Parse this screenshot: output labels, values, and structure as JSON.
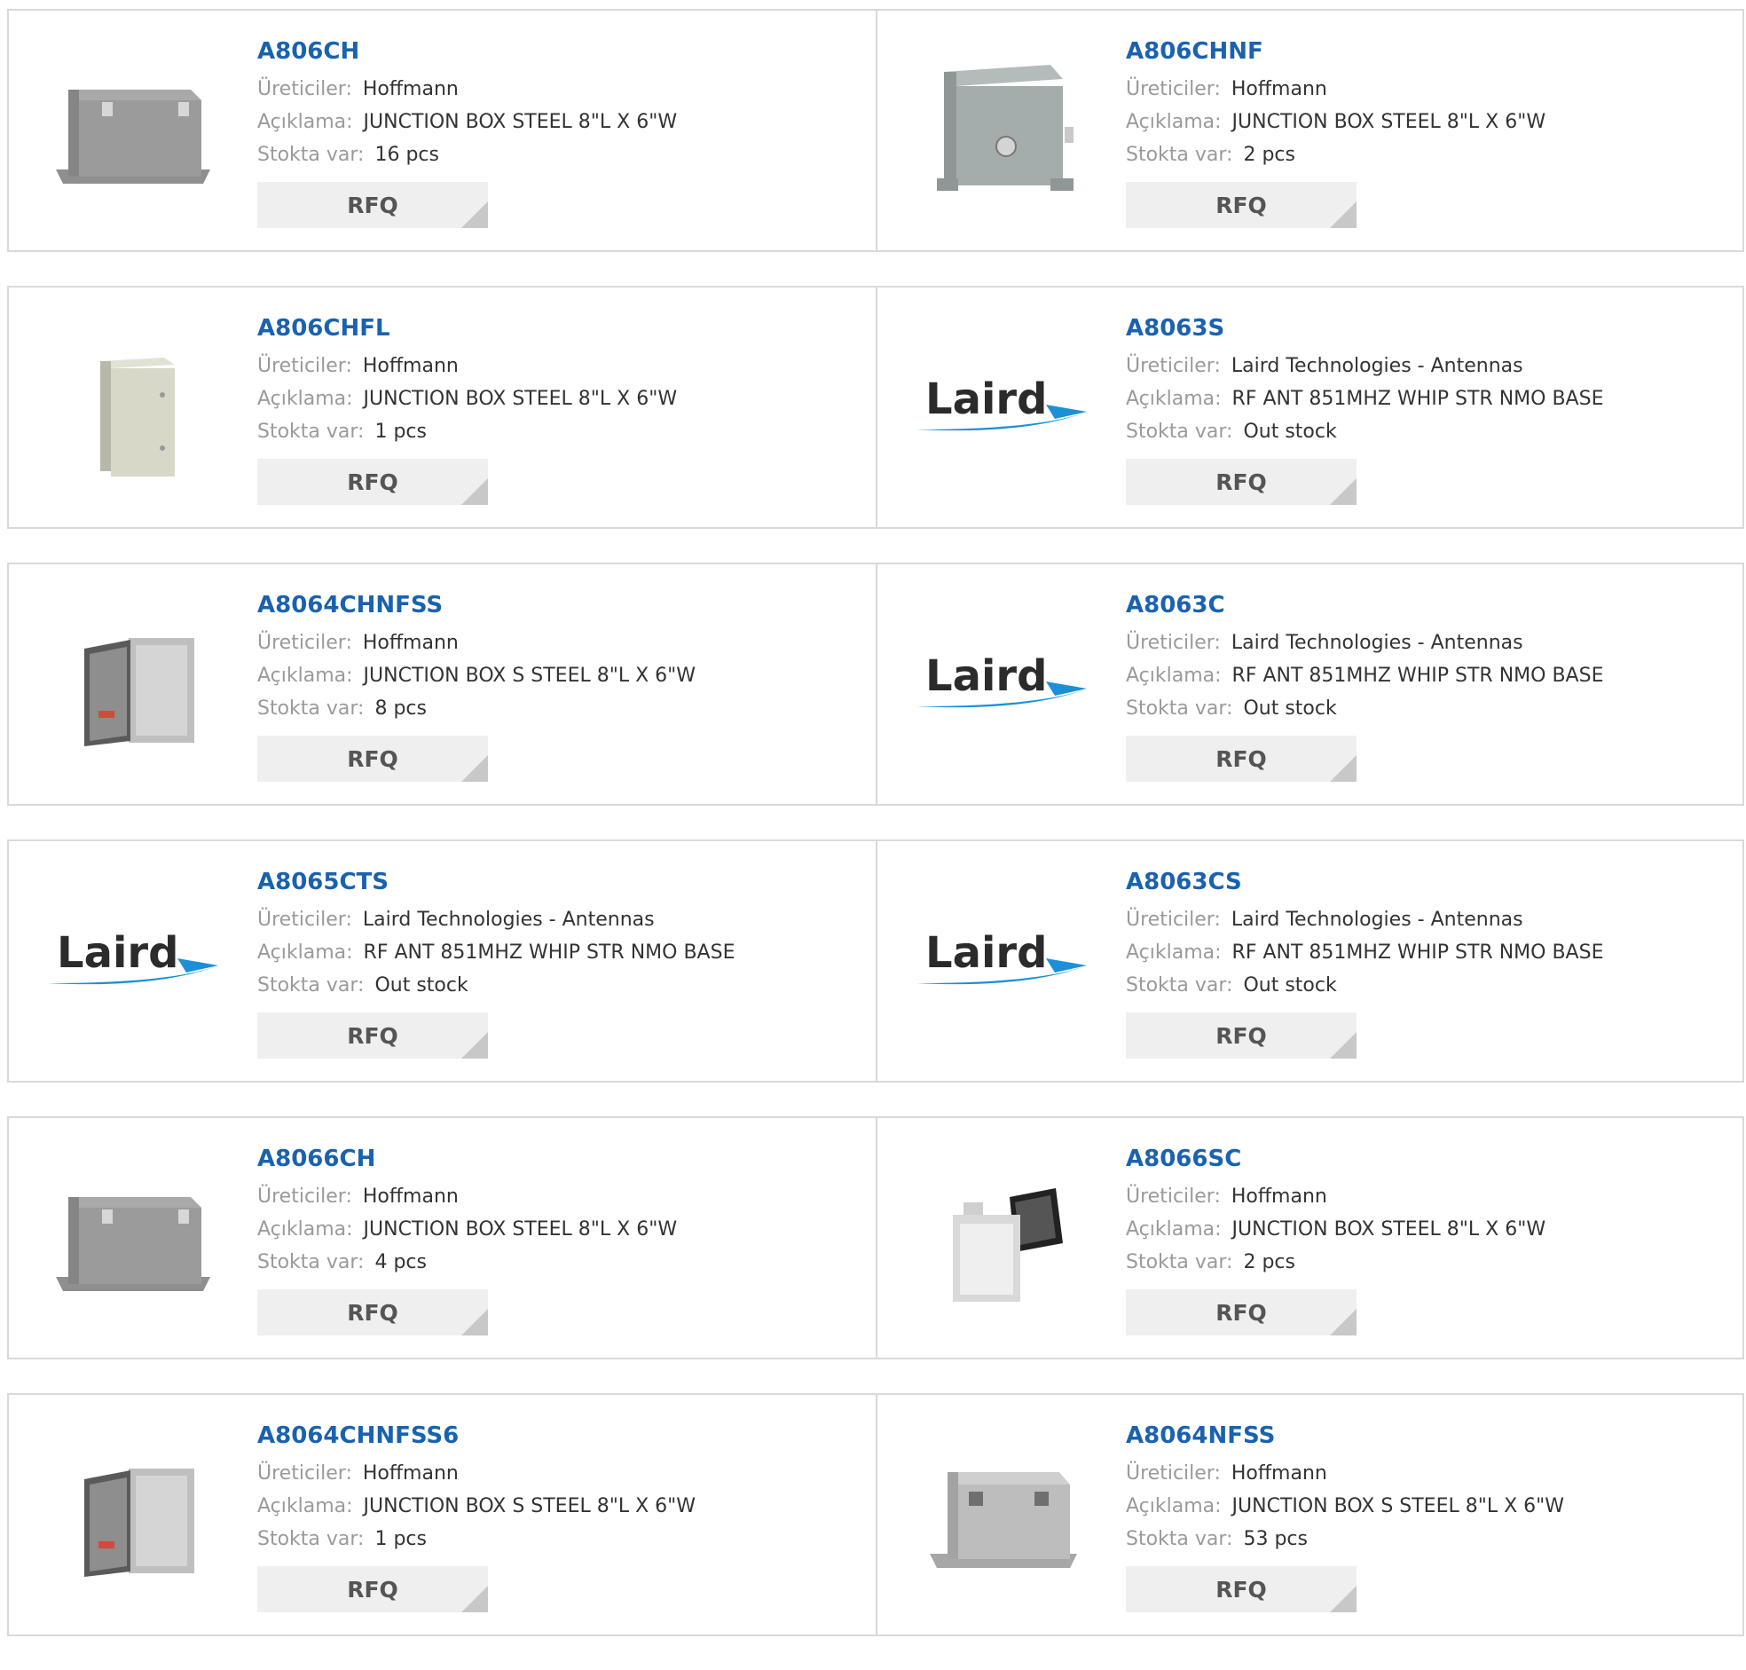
{
  "labels": {
    "manufacturer": "Üreticiler:",
    "description": "Açıklama:",
    "stock": "Stokta var:",
    "rfq": "RFQ"
  },
  "products": [
    {
      "part": "A806CH",
      "manufacturer": "Hoffmann",
      "description": "JUNCTION BOX STEEL 8\"L X 6\"W",
      "stock": "16 pcs",
      "image": "gray-enclosure-latches-icon"
    },
    {
      "part": "A806CHNF",
      "manufacturer": "Hoffmann",
      "description": "JUNCTION BOX STEEL 8\"L X 6\"W",
      "stock": "2 pcs",
      "image": "gray-enclosure-front-latch-icon"
    },
    {
      "part": "A806CHFL",
      "manufacturer": "Hoffmann",
      "description": "JUNCTION BOX STEEL 8\"L X 6\"W",
      "stock": "1 pcs",
      "image": "beige-enclosure-icon"
    },
    {
      "part": "A8063S",
      "manufacturer": "Laird Technologies - Antennas",
      "description": "RF ANT 851MHZ WHIP STR NMO BASE",
      "stock": "Out stock",
      "image": "laird-logo"
    },
    {
      "part": "A8064CHNFSS",
      "manufacturer": "Hoffmann",
      "description": "JUNCTION BOX S STEEL 8\"L X 6\"W",
      "stock": "8 pcs",
      "image": "stainless-enclosure-open-icon"
    },
    {
      "part": "A8063C",
      "manufacturer": "Laird Technologies - Antennas",
      "description": "RF ANT 851MHZ WHIP STR NMO BASE",
      "stock": "Out stock",
      "image": "laird-logo"
    },
    {
      "part": "A8065CTS",
      "manufacturer": "Laird Technologies - Antennas",
      "description": "RF ANT 851MHZ WHIP STR NMO BASE",
      "stock": "Out stock",
      "image": "laird-logo"
    },
    {
      "part": "A8063CS",
      "manufacturer": "Laird Technologies - Antennas",
      "description": "RF ANT 851MHZ WHIP STR NMO BASE",
      "stock": "Out stock",
      "image": "laird-logo"
    },
    {
      "part": "A8066CH",
      "manufacturer": "Hoffmann",
      "description": "JUNCTION BOX STEEL 8\"L X 6\"W",
      "stock": "4 pcs",
      "image": "gray-enclosure-latches-icon"
    },
    {
      "part": "A8066SC",
      "manufacturer": "Hoffmann",
      "description": "JUNCTION BOX STEEL 8\"L X 6\"W",
      "stock": "2 pcs",
      "image": "white-enclosure-open-lid-icon"
    },
    {
      "part": "A8064CHNFSS6",
      "manufacturer": "Hoffmann",
      "description": "JUNCTION BOX S STEEL 8\"L X 6\"W",
      "stock": "1 pcs",
      "image": "stainless-enclosure-open-icon"
    },
    {
      "part": "A8064NFSS",
      "manufacturer": "Hoffmann",
      "description": "JUNCTION BOX S STEEL 8\"L X 6\"W",
      "stock": "53 pcs",
      "image": "stainless-enclosure-latches-icon"
    }
  ],
  "colors": {
    "part_link": "#1a62b0",
    "label": "#9a9a9a",
    "value": "#333333",
    "border": "#d9d9d9",
    "button_bg": "#efefef",
    "laird_blue": "#1c8fd8"
  },
  "logo_text": "Laird"
}
